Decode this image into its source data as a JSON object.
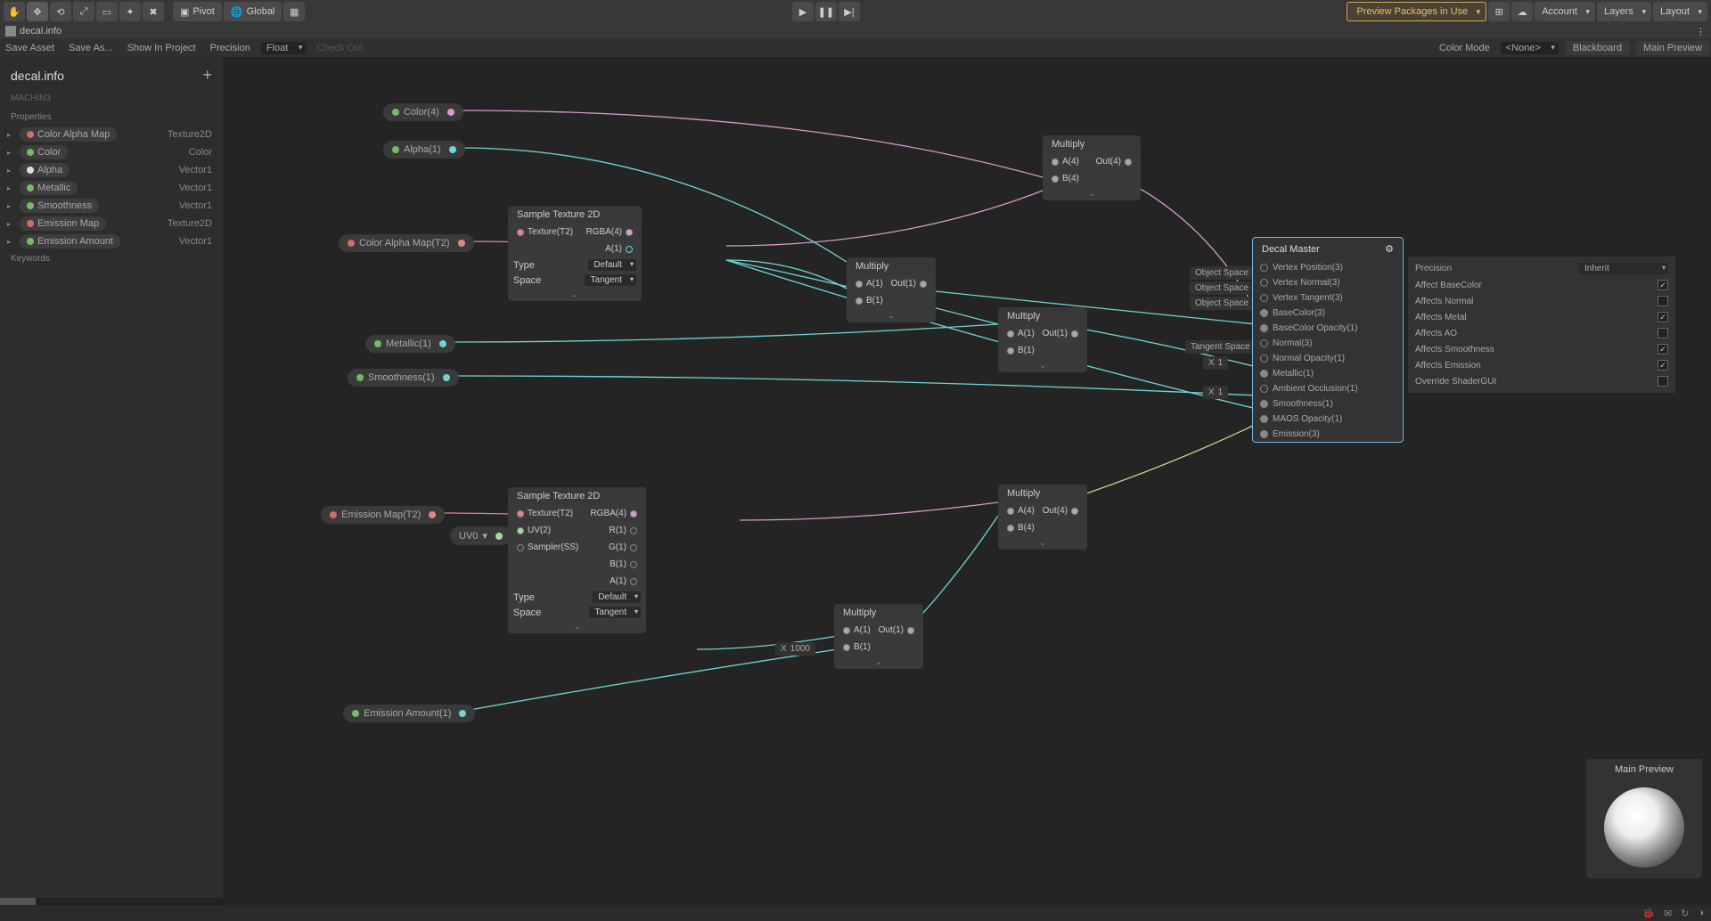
{
  "topbar": {
    "pivot": "Pivot",
    "global": "Global",
    "preview_packages": "Preview Packages in Use",
    "account": "Account",
    "layers": "Layers",
    "layout": "Layout"
  },
  "title": {
    "file": "decal.info"
  },
  "secondbar": {
    "save_asset": "Save Asset",
    "save_as": "Save As...",
    "show_in_project": "Show In Project",
    "precision": "Precision",
    "precision_val": "Float",
    "check_out": "Check Out",
    "color_mode": "Color Mode",
    "color_mode_val": "<None>",
    "blackboard": "Blackboard",
    "main_preview": "Main Preview"
  },
  "sidebar": {
    "title": "decal.info",
    "sub": "MACHIN3",
    "properties": "Properties",
    "keywords": "Keywords",
    "props": [
      {
        "dot": "red",
        "label": "Color Alpha Map",
        "type": "Texture2D"
      },
      {
        "dot": "green",
        "label": "Color",
        "type": "Color"
      },
      {
        "dot": "alpha",
        "label": "Alpha",
        "type": "Vector1"
      },
      {
        "dot": "green",
        "label": "Metallic",
        "type": "Vector1"
      },
      {
        "dot": "green",
        "label": "Smoothness",
        "type": "Vector1"
      },
      {
        "dot": "red",
        "label": "Emission Map",
        "type": "Texture2D"
      },
      {
        "dot": "green",
        "label": "Emission Amount",
        "type": "Vector1"
      }
    ]
  },
  "pills": {
    "color": "Color(4)",
    "alpha": "Alpha(1)",
    "coloralphamap": "Color Alpha Map(T2)",
    "metallic": "Metallic(1)",
    "smoothness": "Smoothness(1)",
    "emissionmap": "Emission Map(T2)",
    "uv": "UV0",
    "emissionamount": "Emission Amount(1)"
  },
  "sampletex": {
    "title": "Sample Texture 2D",
    "texture": "Texture(T2)",
    "rgba": "RGBA(4)",
    "a": "A(1)",
    "type": "Type",
    "type_val": "Default",
    "space": "Space",
    "space_val": "Tangent",
    "uv": "UV(2)",
    "sampler": "Sampler(SS)",
    "r": "R(1)",
    "g": "G(1)",
    "b": "B(1)"
  },
  "multiply": {
    "title": "Multiply",
    "a1": "A(1)",
    "b1": "B(1)",
    "out1": "Out(1)",
    "a4": "A(4)",
    "b4": "B(4)",
    "out4": "Out(4)"
  },
  "inputx": {
    "x": "X",
    "one": "1",
    "thousand": "1000"
  },
  "master": {
    "title": "Decal Master",
    "obj_space": "Object Space",
    "tan_space": "Tangent Space",
    "ports": [
      "Vertex Position(3)",
      "Vertex Normal(3)",
      "Vertex Tangent(3)",
      "BaseColor(3)",
      "BaseColor Opacity(1)",
      "Normal(3)",
      "Normal Opacity(1)",
      "Metallic(1)",
      "Ambient Occlusion(1)",
      "Smoothness(1)",
      "MAOS Opacity(1)",
      "Emission(3)"
    ]
  },
  "settings": {
    "precision": "Precision",
    "precision_val": "Inherit",
    "rows": [
      {
        "label": "Affect BaseColor",
        "checked": true
      },
      {
        "label": "Affects Normal",
        "checked": false
      },
      {
        "label": "Affects Metal",
        "checked": true
      },
      {
        "label": "Affects AO",
        "checked": false
      },
      {
        "label": "Affects Smoothness",
        "checked": true
      },
      {
        "label": "Affects Emission",
        "checked": true
      },
      {
        "label": "Override ShaderGUI",
        "checked": false
      }
    ]
  },
  "preview": {
    "title": "Main Preview"
  }
}
